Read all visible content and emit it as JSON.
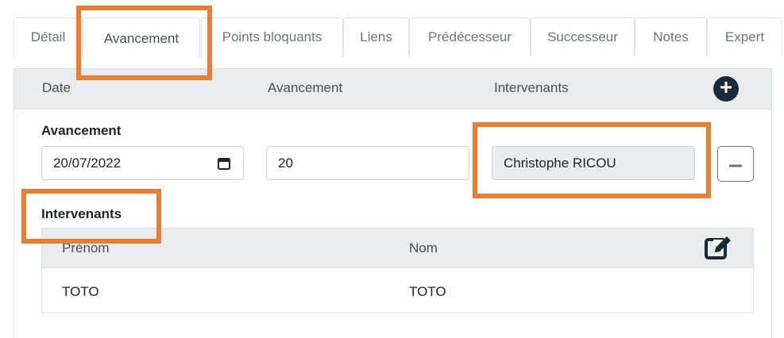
{
  "tabs": [
    {
      "label": "Détail"
    },
    {
      "label": "Avancement"
    },
    {
      "label": "Points bloquants"
    },
    {
      "label": "Liens"
    },
    {
      "label": "Prédécesseur"
    },
    {
      "label": "Successeur"
    },
    {
      "label": "Notes"
    },
    {
      "label": "Expert"
    }
  ],
  "active_tab": "Avancement",
  "list_header": {
    "date": "Date",
    "avancement": "Avancement",
    "intervenants": "Intervenants",
    "add_icon": "plus-circle-icon"
  },
  "form": {
    "avancement_label": "Avancement",
    "date_value": "20/07/2022",
    "avancement_value": "20",
    "intervenant_value": "Christophe RICOU",
    "intervenants_label": "Intervenants"
  },
  "intervenants_table": {
    "columns": [
      "Prénom",
      "Nom"
    ],
    "rows": [
      [
        "TOTO",
        "TOTO"
      ]
    ],
    "edit_icon": "edit-icon"
  },
  "colors": {
    "annotation": "#ed7d31",
    "header_bg": "#e9ecef",
    "add_button": "#1b2a3a"
  }
}
